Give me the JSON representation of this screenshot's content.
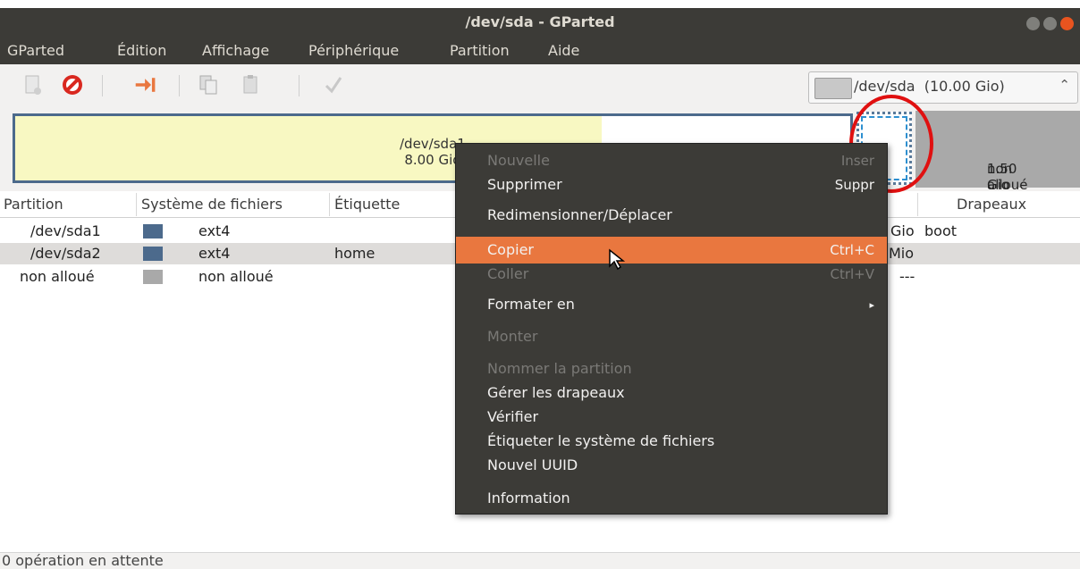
{
  "window": {
    "title": "/dev/sda - GParted"
  },
  "menubar": [
    "GParted",
    "Édition",
    "Affichage",
    "Périphérique",
    "Partition",
    "Aide"
  ],
  "toolbar": {
    "icons": [
      "new-icon",
      "delete-icon",
      "resize-move-icon",
      "copy-icon",
      "paste-icon",
      "apply-icon"
    ],
    "device_selector": "/dev/sda  (10.00 Gio)"
  },
  "graph": {
    "sda1_label": "/dev/sda1",
    "sda1_size": "8.00 Gio",
    "unallocated_label": "non alloué",
    "unallocated_size": "1.50 Gio"
  },
  "table": {
    "headers": [
      "Partition",
      "Système de fichiers",
      "Étiquette",
      "Drapeaux"
    ],
    "rows": [
      {
        "partition": "/dev/sda1",
        "fs": "ext4",
        "label": "",
        "size_tail": "Gio",
        "flags": "boot",
        "color": "#4c6a8c"
      },
      {
        "partition": "/dev/sda2",
        "fs": "ext4",
        "label": "home",
        "size_tail": "Mio",
        "flags": "",
        "color": "#4c6a8c"
      },
      {
        "partition": "non alloué",
        "fs": "non alloué",
        "label": "",
        "size_tail": "---",
        "flags": "",
        "color": "#a9a9a9"
      }
    ]
  },
  "context_menu": {
    "items": [
      {
        "label": "Nouvelle",
        "shortcut": "Inser",
        "enabled": false
      },
      {
        "label": "Supprimer",
        "shortcut": "Suppr",
        "enabled": true
      },
      {
        "label": "Redimensionner/Déplacer",
        "shortcut": "",
        "enabled": true
      },
      {
        "label": "Copier",
        "shortcut": "Ctrl+C",
        "enabled": true,
        "highlighted": true
      },
      {
        "label": "Coller",
        "shortcut": "Ctrl+V",
        "enabled": false
      },
      {
        "label": "Formater en",
        "shortcut": "▸",
        "enabled": true
      },
      {
        "label": "Monter",
        "shortcut": "",
        "enabled": false
      },
      {
        "label": "Nommer la partition",
        "shortcut": "",
        "enabled": false
      },
      {
        "label": "Gérer les drapeaux",
        "shortcut": "",
        "enabled": true
      },
      {
        "label": "Vérifier",
        "shortcut": "",
        "enabled": true
      },
      {
        "label": "Étiqueter le système de fichiers",
        "shortcut": "",
        "enabled": true
      },
      {
        "label": "Nouvel UUID",
        "shortcut": "",
        "enabled": true
      },
      {
        "label": "Information",
        "shortcut": "",
        "enabled": true
      }
    ]
  },
  "status": "0 opération en attente",
  "colors": {
    "accent": "#e9773f",
    "menu_bg": "#3c3b37",
    "annotation": "#e01010"
  }
}
